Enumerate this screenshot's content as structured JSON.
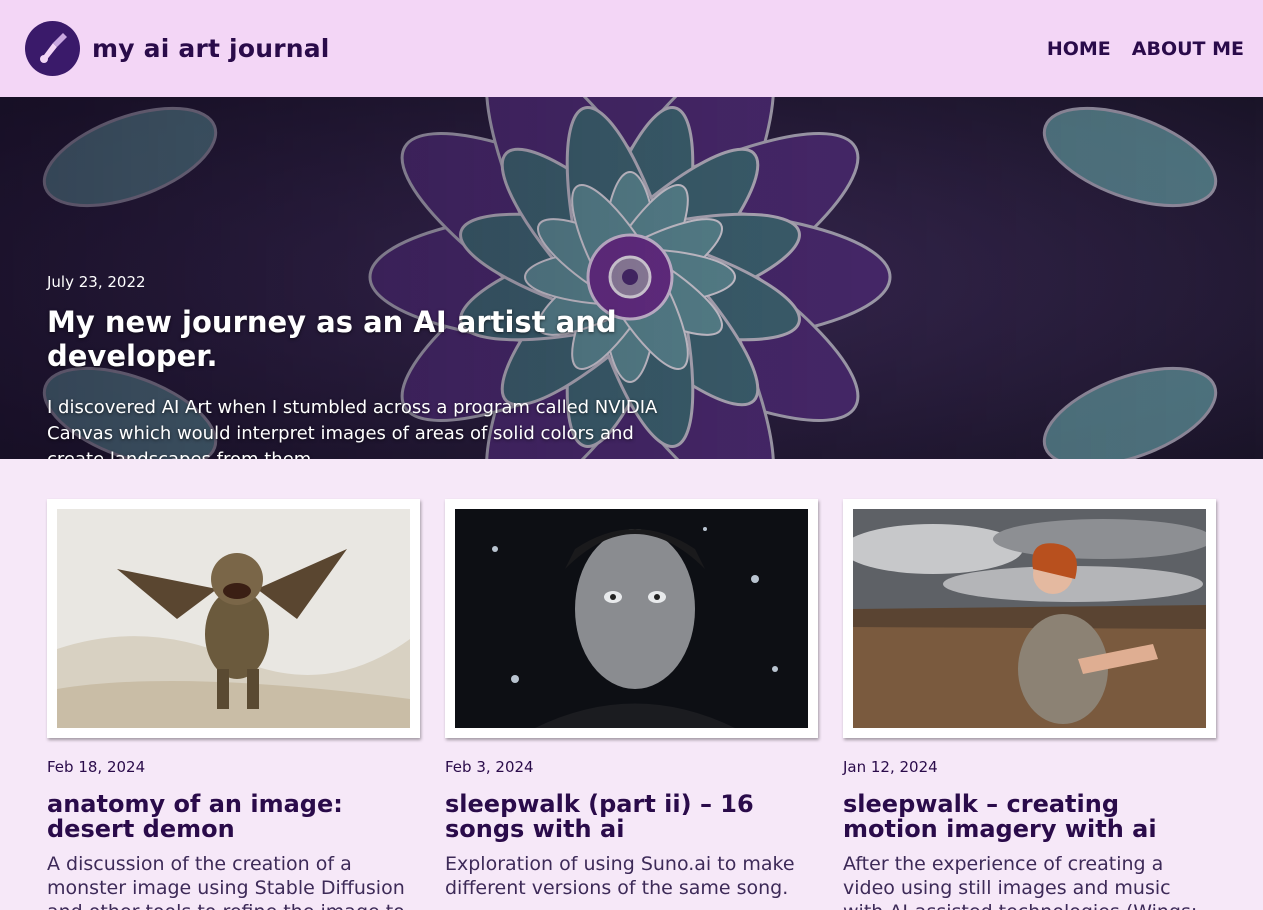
{
  "header": {
    "site_title": "my ai art journal",
    "logo_icon": "brush-hand-icon",
    "nav": [
      {
        "label": "HOME"
      },
      {
        "label": "ABOUT ME"
      }
    ]
  },
  "hero": {
    "date": "July 23, 2022",
    "title": "My new journey as an AI artist and developer.",
    "excerpt": "I discovered AI Art when I stumbled across a program called NVIDIA Canvas which would interpret images of areas of solid colors and create landscapes from them."
  },
  "posts": [
    {
      "date": "Feb 18, 2024",
      "title": "anatomy of an image: desert demon",
      "excerpt": "A discussion of the creation of a monster image using Stable Diffusion and other tools to refine the image to match my"
    },
    {
      "date": "Feb 3, 2024",
      "title": "sleepwalk (part ii) – 16 songs with ai",
      "excerpt": "Exploration of using Suno.ai to make different versions of the same song."
    },
    {
      "date": "Jan 12, 2024",
      "title": "sleepwalk – creating motion imagery with ai",
      "excerpt": "After the experience of creating a video using still images and music with AI-assisted technologies (Wings: The"
    }
  ],
  "colors": {
    "header_bg": "#f3d6f6",
    "page_bg": "#f6e8f8",
    "text": "#2a0b4a"
  }
}
